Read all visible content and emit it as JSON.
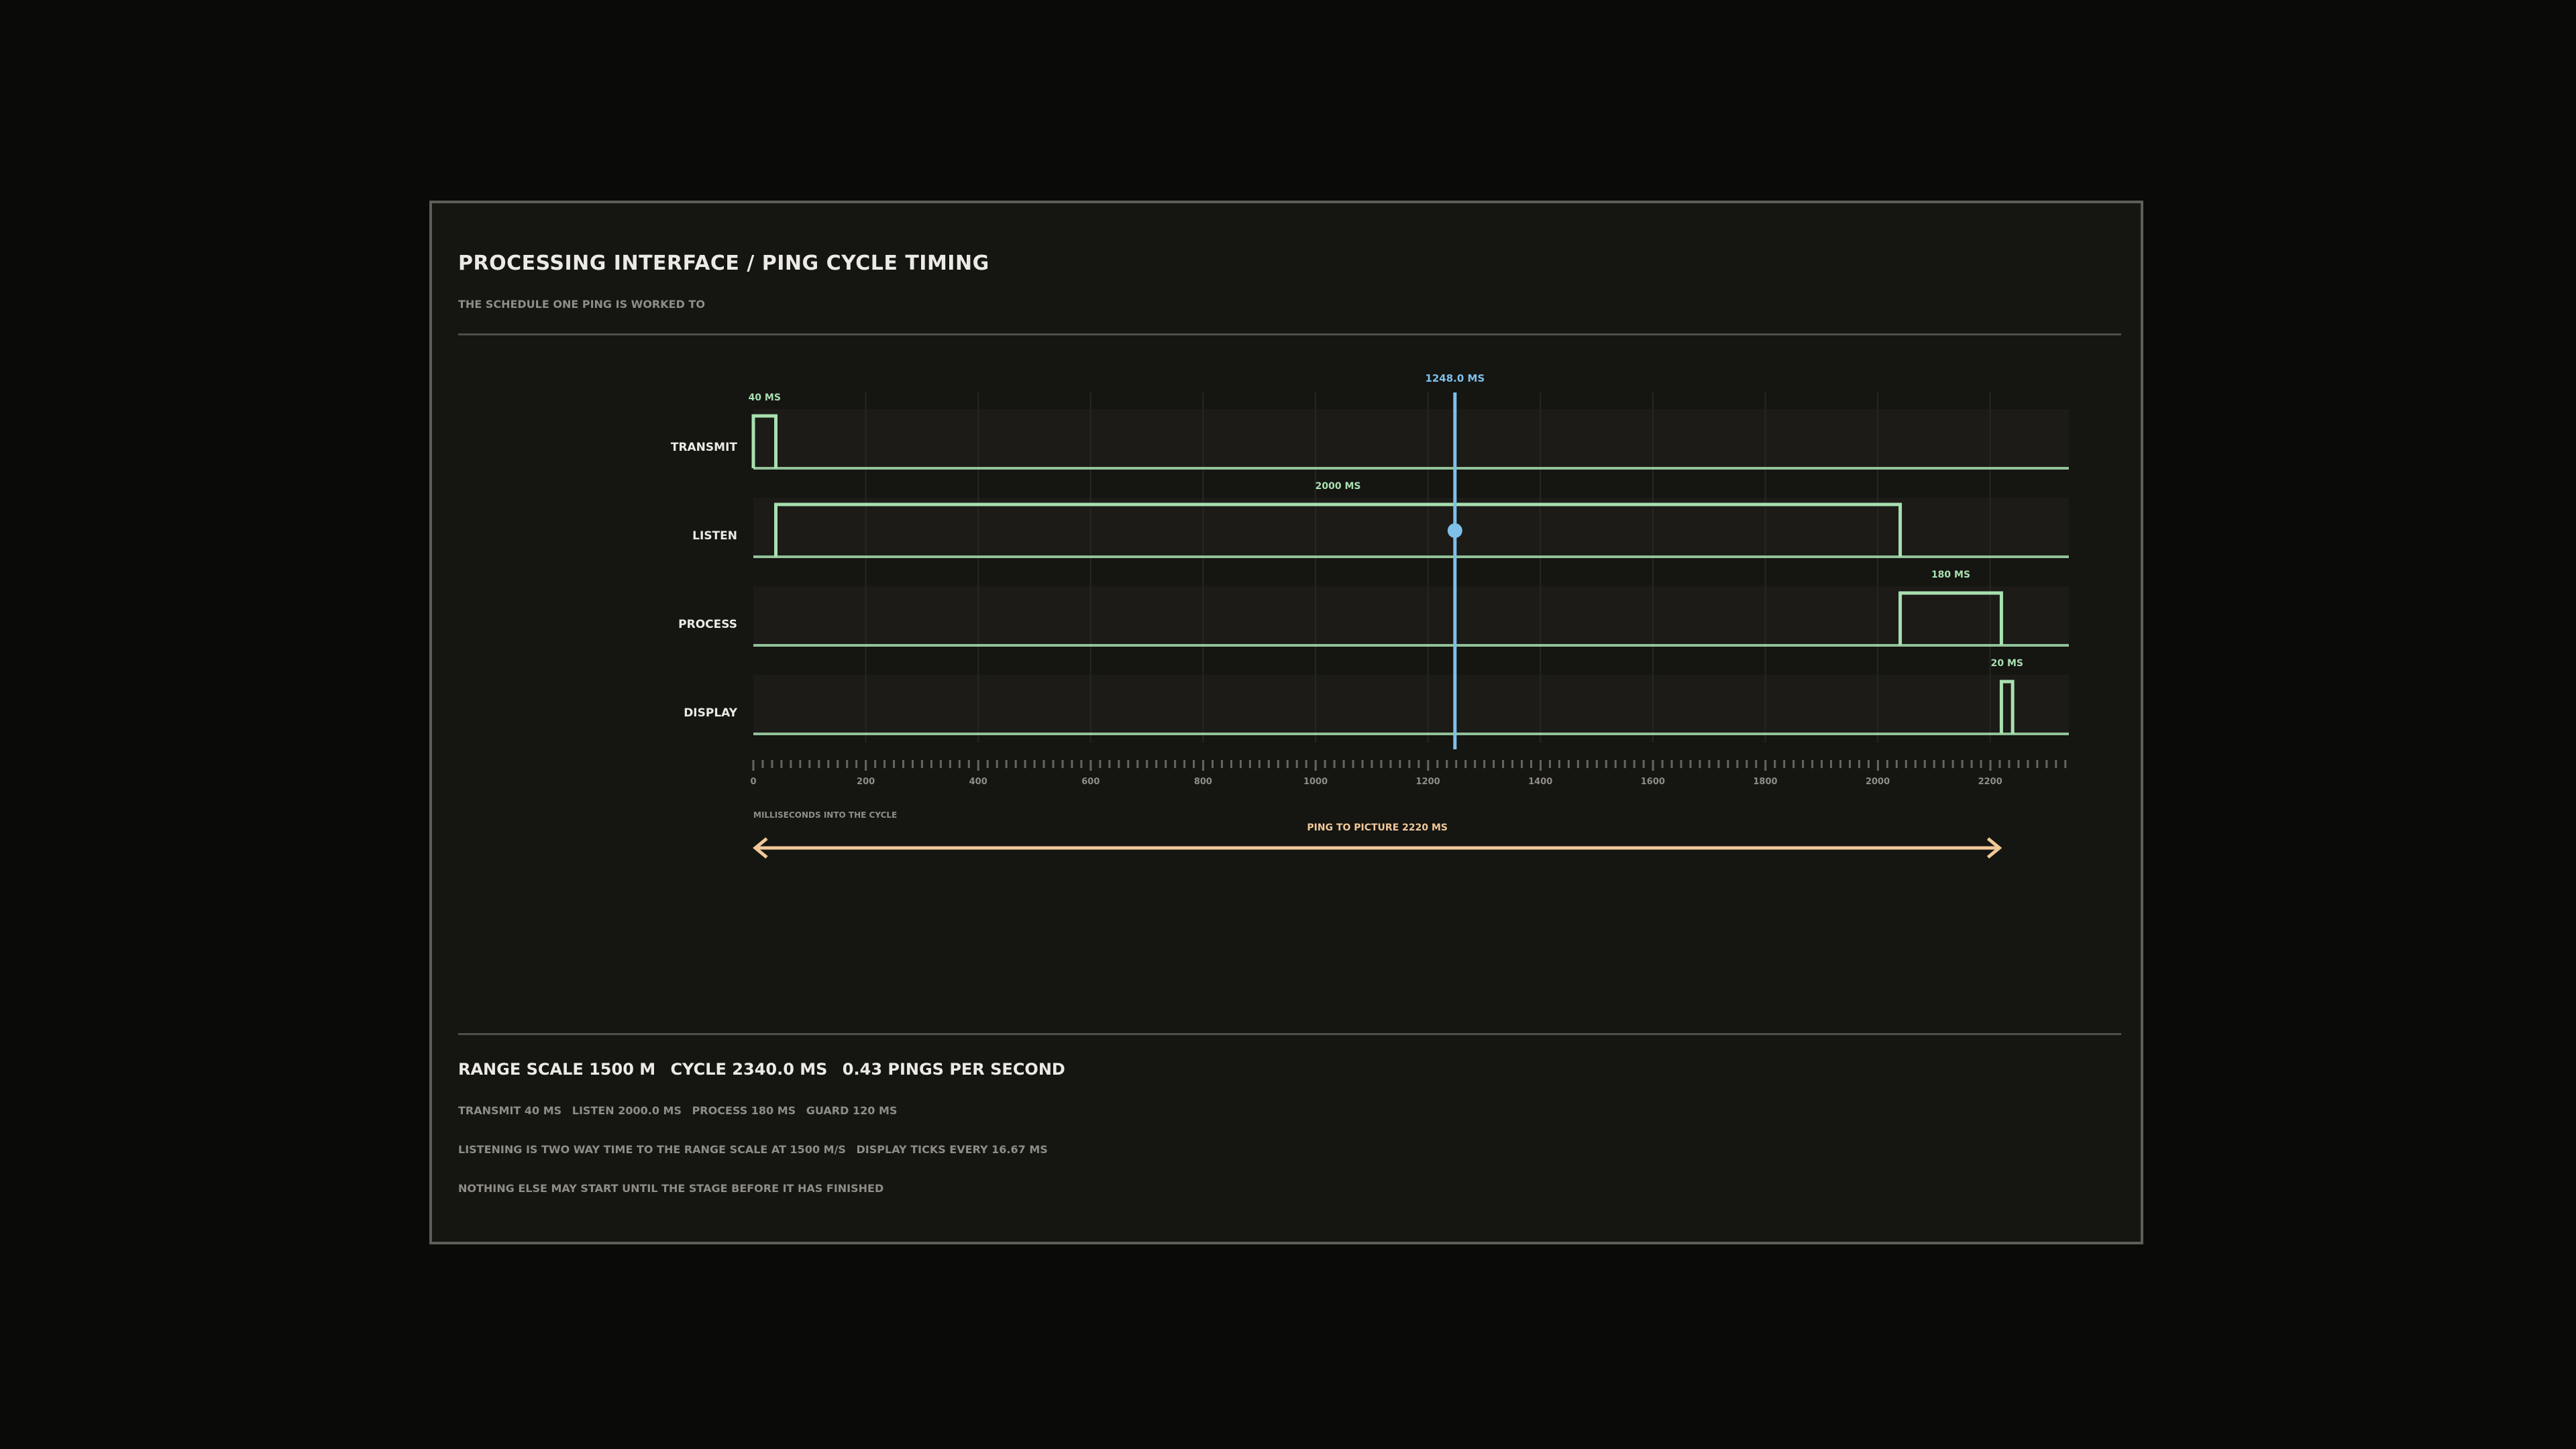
{
  "header": {
    "title": "PROCESSING INTERFACE / PING CYCLE TIMING",
    "subtitle": "THE SCHEDULE ONE PING IS WORKED TO"
  },
  "chart_data": {
    "type": "timing",
    "xlabel": "MILLISECONDS INTO THE CYCLE",
    "xlim": [
      0,
      2340
    ],
    "ticks": [
      0,
      200,
      400,
      600,
      800,
      1000,
      1200,
      1400,
      1600,
      1800,
      2000,
      2200
    ],
    "minor_tick_step_ms": 16.67,
    "stages": [
      {
        "name": "TRANSMIT",
        "start": 0,
        "end": 40,
        "label": "40 MS"
      },
      {
        "name": "LISTEN",
        "start": 40,
        "end": 2040,
        "label": "2000 MS"
      },
      {
        "name": "PROCESS",
        "start": 2040,
        "end": 2220,
        "label": "180 MS"
      },
      {
        "name": "DISPLAY",
        "start": 2220,
        "end": 2240,
        "label": "20 MS"
      }
    ],
    "cursor": {
      "value": 1248,
      "label": "1248.0 MS",
      "stage": "LISTEN"
    },
    "span": {
      "start": 0,
      "end": 2220,
      "label": "PING TO PICTURE 2220 MS"
    },
    "colors": {
      "signal": "#a8e0b0",
      "cursor": "#7ec0ea",
      "span": "#f0c898",
      "grid": "#262622",
      "lane": "#1c1b18",
      "tick_label": "#8e8d86",
      "row_label": "#eceae4"
    }
  },
  "footer": {
    "stats": [
      "RANGE SCALE 1500 M",
      "CYCLE 2340.0 MS",
      "0.43 PINGS PER SECOND"
    ],
    "timings": [
      "TRANSMIT 40 MS",
      "LISTEN 2000.0 MS",
      "PROCESS 180 MS",
      "GUARD 120 MS"
    ],
    "notes_line": [
      "LISTENING IS TWO WAY TIME TO THE RANGE SCALE AT 1500 M/S",
      "DISPLAY TICKS EVERY 16.67 MS"
    ],
    "final_note": "NOTHING ELSE MAY START UNTIL THE STAGE BEFORE IT HAS FINISHED"
  }
}
